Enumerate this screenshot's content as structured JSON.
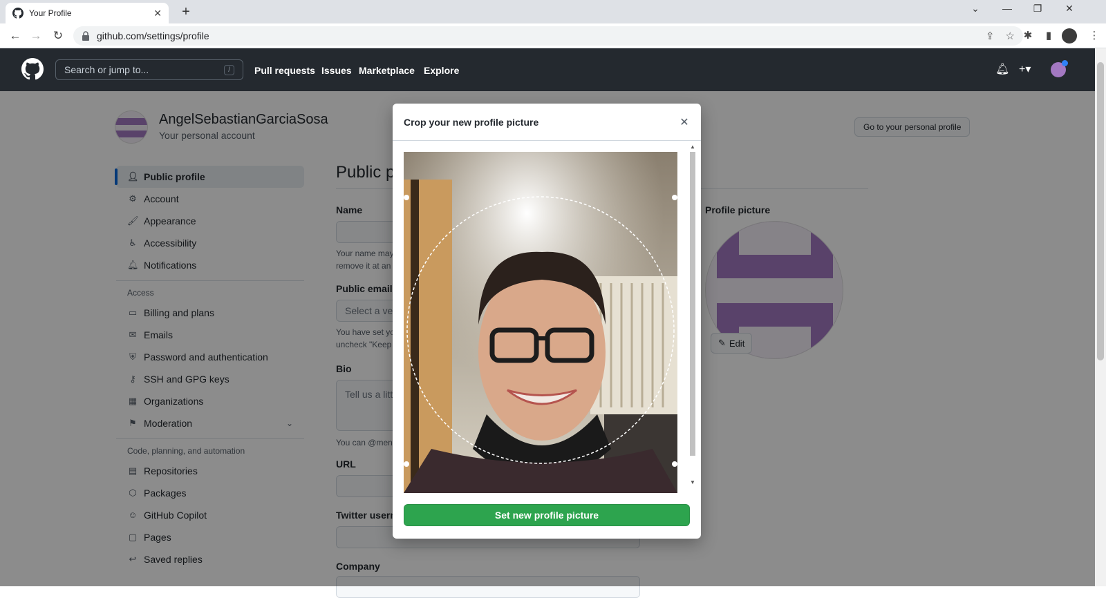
{
  "browser": {
    "tab_title": "Your Profile",
    "url": "github.com/settings/profile"
  },
  "github": {
    "search_placeholder": "Search or jump to...",
    "search_shortcut": "/",
    "nav": [
      "Pull requests",
      "Issues",
      "Marketplace",
      "Explore"
    ]
  },
  "account": {
    "username": "AngelSebastianGarciaSosa",
    "subtitle": "Your personal account",
    "go_to_profile_label": "Go to your personal profile"
  },
  "sidebar": {
    "items": [
      {
        "label": "Public profile",
        "icon": "person-icon",
        "active": true
      },
      {
        "label": "Account",
        "icon": "gear-icon"
      },
      {
        "label": "Appearance",
        "icon": "paintbrush-icon"
      },
      {
        "label": "Accessibility",
        "icon": "accessibility-icon"
      },
      {
        "label": "Notifications",
        "icon": "bell-icon"
      }
    ],
    "access_heading": "Access",
    "access_items": [
      {
        "label": "Billing and plans",
        "icon": "credit-card-icon"
      },
      {
        "label": "Emails",
        "icon": "mail-icon"
      },
      {
        "label": "Password and authentication",
        "icon": "shield-lock-icon"
      },
      {
        "label": "SSH and GPG keys",
        "icon": "key-icon"
      },
      {
        "label": "Organizations",
        "icon": "organization-icon"
      },
      {
        "label": "Moderation",
        "icon": "report-icon"
      }
    ],
    "code_heading": "Code, planning, and automation",
    "code_items": [
      {
        "label": "Repositories",
        "icon": "repo-icon"
      },
      {
        "label": "Packages",
        "icon": "package-icon"
      },
      {
        "label": "GitHub Copilot",
        "icon": "copilot-icon"
      },
      {
        "label": "Pages",
        "icon": "browser-icon"
      },
      {
        "label": "Saved replies",
        "icon": "reply-icon"
      }
    ]
  },
  "main": {
    "title": "Public p",
    "name_label": "Name",
    "name_note_1": "Your name may",
    "name_note_2": "remove it at an",
    "email_label": "Public email",
    "email_placeholder": "Select a ve",
    "email_note_1": "You have set yo",
    "email_note_2": "uncheck \"Keep",
    "bio_label": "Bio",
    "bio_placeholder": "Tell us a litt",
    "bio_note": "You can @men",
    "url_label": "URL",
    "twitter_label": "Twitter usern",
    "company_label": "Company",
    "profile_picture_label": "Profile picture",
    "edit_label": "Edit"
  },
  "modal": {
    "title": "Crop your new profile picture",
    "set_button": "Set new profile picture"
  },
  "colors": {
    "header_bg": "#24292f",
    "primary_button": "#2da44e",
    "avatar_purple": "#a378c2"
  }
}
